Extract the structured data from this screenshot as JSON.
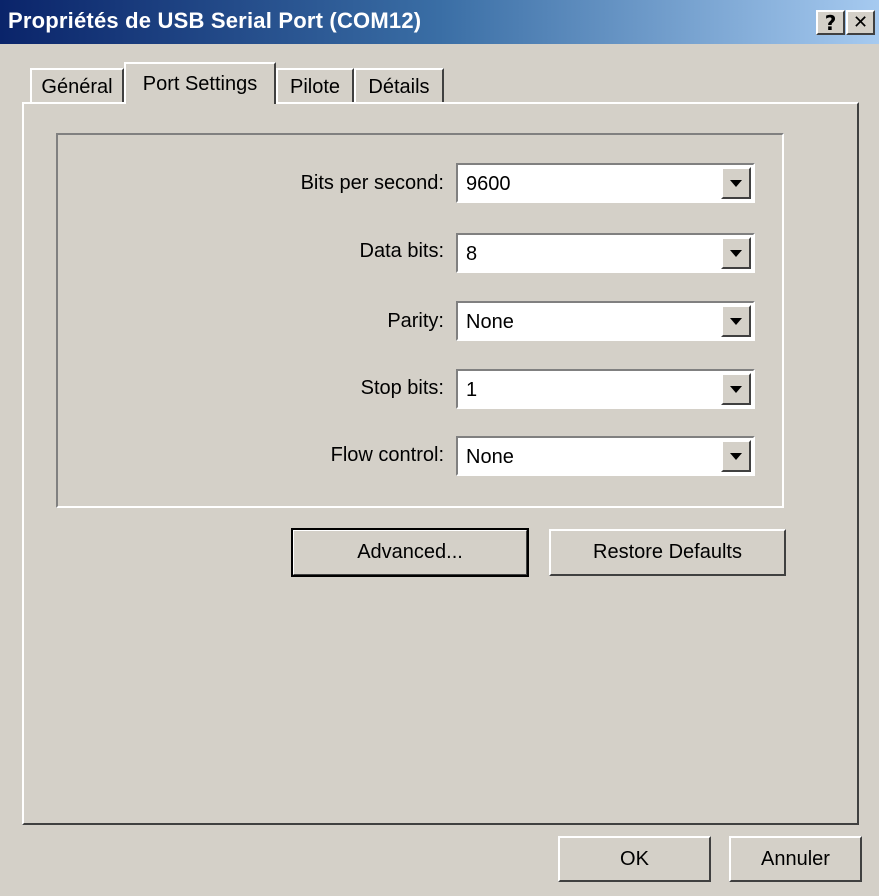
{
  "window": {
    "title": "Propriétés de USB Serial Port (COM12)",
    "help_glyph": "?",
    "close_glyph": "✕"
  },
  "tabs": [
    {
      "label": "Général",
      "active": false
    },
    {
      "label": "Port Settings",
      "active": true
    },
    {
      "label": "Pilote",
      "active": false
    },
    {
      "label": "Détails",
      "active": false
    }
  ],
  "port_settings": {
    "fields": [
      {
        "label": "Bits per second:",
        "value": "9600"
      },
      {
        "label": "Data bits:",
        "value": "8"
      },
      {
        "label": "Parity:",
        "value": "None"
      },
      {
        "label": "Stop bits:",
        "value": "1"
      },
      {
        "label": "Flow control:",
        "value": "None"
      }
    ],
    "advanced_label": "Advanced...",
    "restore_defaults_label": "Restore Defaults"
  },
  "footer": {
    "ok_label": "OK",
    "cancel_label": "Annuler"
  },
  "colors": {
    "title_gradient_start": "#0a246a",
    "title_gradient_end": "#a6caf0",
    "face": "#d4d0c8"
  }
}
